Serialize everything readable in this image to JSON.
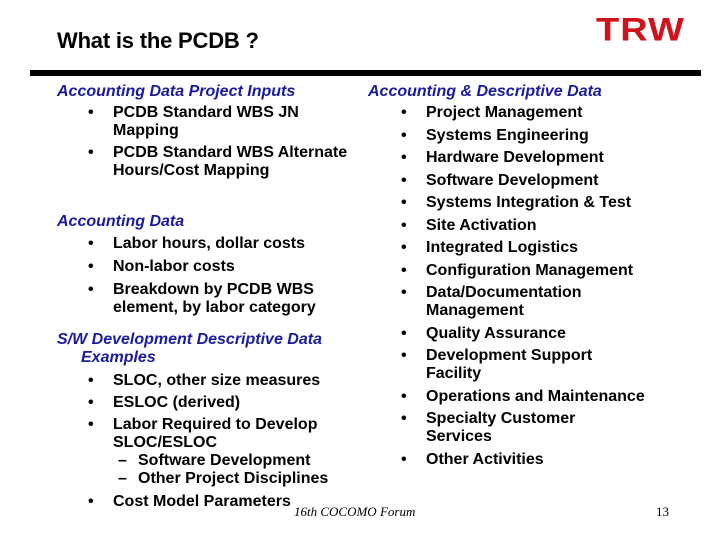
{
  "slide": {
    "title": "What is the PCDB ?",
    "logo_text": "TRW",
    "brand_color": "#d0121a",
    "heading_color": "#1a1a9c",
    "left": {
      "sections": [
        {
          "heading": "Accounting Data Project Inputs",
          "items": [
            "PCDB Standard WBS JN Mapping",
            "PCDB Standard WBS Alternate Hours/Cost Mapping"
          ]
        },
        {
          "heading": "Accounting Data",
          "items": [
            "Labor hours, dollar costs",
            "Non-labor costs",
            "Breakdown by PCDB WBS element, by labor category"
          ]
        },
        {
          "heading_line1": "S/W Development Descriptive Data",
          "heading_line2": "Examples",
          "items": [
            "SLOC, other size measures",
            "ESLOC (derived)",
            "Labor Required to Develop SLOC/ESLOC",
            "Cost Model Parameters"
          ],
          "subitems": [
            "Software Development",
            "Other Project Disciplines"
          ]
        }
      ]
    },
    "right": {
      "heading": "Accounting & Descriptive Data",
      "items": [
        "Project Management",
        "Systems Engineering",
        "Hardware Development",
        "Software Development",
        "Systems Integration & Test",
        "Site Activation",
        "Integrated Logistics",
        "Configuration Management",
        "Data/Documentation Management",
        "Quality Assurance",
        "Development Support Facility",
        "Operations and Maintenance",
        "Specialty Customer Services",
        "Other Activities"
      ]
    },
    "bullet_glyph": "•",
    "dash_glyph": "–",
    "footer": "16th COCOMO Forum",
    "page_number": "13"
  }
}
